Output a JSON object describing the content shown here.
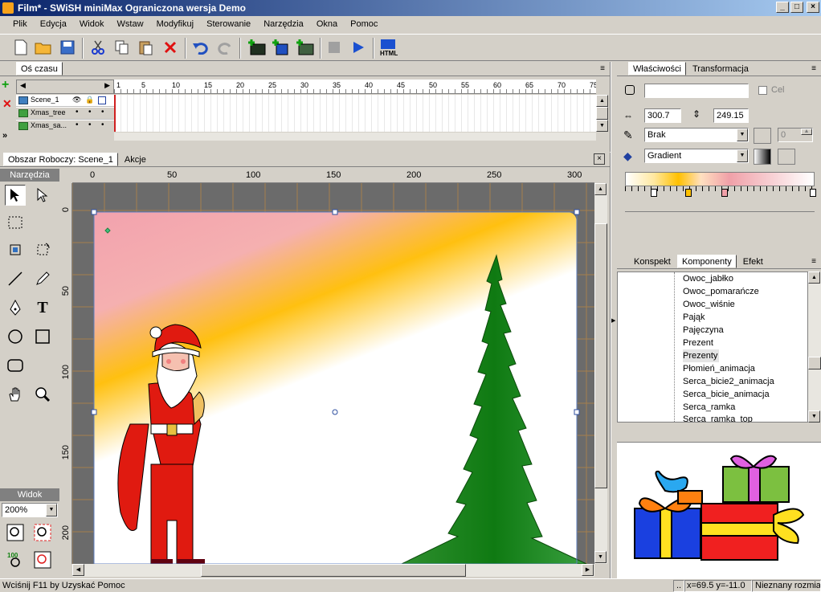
{
  "window": {
    "title": "Film* - SWiSH miniMax Ograniczona wersja Demo"
  },
  "menu": [
    "Plik",
    "Edycja",
    "Widok",
    "Wstaw",
    "Modyfikuj",
    "Sterowanie",
    "Narzędzia",
    "Okna",
    "Pomoc"
  ],
  "timeline": {
    "tab": "Oś czasu",
    "rows": [
      "Scene_1",
      "Xmas_tree",
      "Xmas_sa..."
    ],
    "frame_labels": [
      "1",
      "5",
      "10",
      "15",
      "20",
      "25",
      "30",
      "35",
      "40",
      "45",
      "50",
      "55",
      "60",
      "65",
      "70",
      "75"
    ]
  },
  "workspace": {
    "tab_active": "Obszar Roboczy: Scene_1",
    "tab_other": "Akcje",
    "ruler_h": [
      "0",
      "50",
      "100",
      "150",
      "200",
      "250",
      "300"
    ],
    "ruler_v": [
      "0",
      "50",
      "100",
      "150",
      "200"
    ]
  },
  "tools": {
    "title": "Narzędzia",
    "view_title": "Widok",
    "zoom": "200%"
  },
  "properties": {
    "tab_active": "Właściwości",
    "tab_other": "Transformacja",
    "name_value": "",
    "target_label": "Cel",
    "width": "300.7",
    "height": "249.15",
    "line_style": "Brak",
    "line_width": "0",
    "fill_style": "Gradient"
  },
  "components": {
    "tabs": [
      "Konspekt",
      "Komponenty",
      "Efekt"
    ],
    "active_tab": "Komponenty",
    "items": [
      "Owoc_jabłko",
      "Owoc_pomarańcze",
      "Owoc_wiśnie",
      "Pająk",
      "Pajęczyna",
      "Prezent",
      "Prezenty",
      "Płomień_animacja",
      "Serca_bicie2_animacja",
      "Serca_bicie_animacja",
      "Serca_ramka",
      "Serca_ramka_top"
    ],
    "selected": "Prezenty"
  },
  "status": {
    "help": "Wciśnij F11 by Uzyskać Pomoc",
    "dots": "..",
    "coords": "x=69.5 y=-11.0",
    "size": "Nieznany rozmiar"
  },
  "colors": {
    "title_start": "#0a246a",
    "title_end": "#a6caf0",
    "gradient_pink": "#f0a0a8",
    "gradient_orange": "#ffc000",
    "tree_green": "#1a8a1a"
  }
}
